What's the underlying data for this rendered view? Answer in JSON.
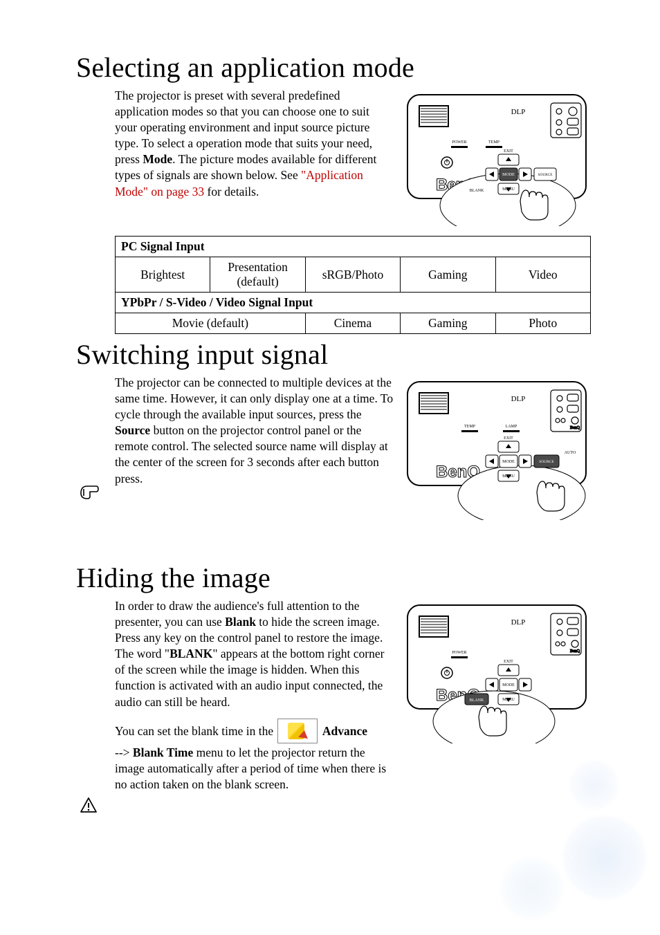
{
  "sec1": {
    "heading": "Selecting an application mode",
    "para_a": "The projector is preset with several predefined application modes so that you can choose one to suit your operating environment and input source picture type. To select a operation mode that suits your need, press ",
    "mode_word": "Mode",
    "para_b": ". The picture modes available for different types of signals are shown below. See ",
    "xref": "\"Application Mode\" on page 33",
    "para_c": " for details."
  },
  "table": {
    "hdr1": "PC Signal Input",
    "r1c1": "Brightest",
    "r1c2a": "Presentation",
    "r1c2b": "(default)",
    "r1c3": "sRGB/Photo",
    "r1c4": "Gaming",
    "r1c5": "Video",
    "hdr2": "YPbPr / S-Video / Video Signal Input",
    "r2c1": "Movie (default)",
    "r2c2": "Cinema",
    "r2c3": "Gaming",
    "r2c4": "Photo"
  },
  "sec2": {
    "heading": "Switching input signal",
    "para_a": "The projector can be connected to multiple devices at the same time. However, it can only display one at a time. To cycle through the available input sources, press the ",
    "source_word": "Source",
    "para_b": " button on the projector control panel or the remote control. The selected source name will display at the center of the screen for 3 seconds after each button press."
  },
  "sec3": {
    "heading": "Hiding the image",
    "para_a": "In order to draw the audience's full attention to the presenter, you can use ",
    "blank_word": "Blank",
    "para_b": " to hide the screen image. Press any key on the control panel to restore the image. The word \"",
    "blank_caps": "BLANK",
    "para_c": "\" appears at the bottom right corner of the screen while the image is hidden. When this function is activated with an audio input connected, the audio can still be heard.",
    "para2_a": "You can set the blank time in the ",
    "advance_word": "Advance",
    "para2_b": " --> ",
    "blanktime_word": "Blank Time",
    "para2_c": " menu to let the projector return the image automatically after a period of time when there is no action taken on the blank screen."
  },
  "icons": {
    "hand": "hand-pointing-icon",
    "caution": "caution-icon"
  }
}
